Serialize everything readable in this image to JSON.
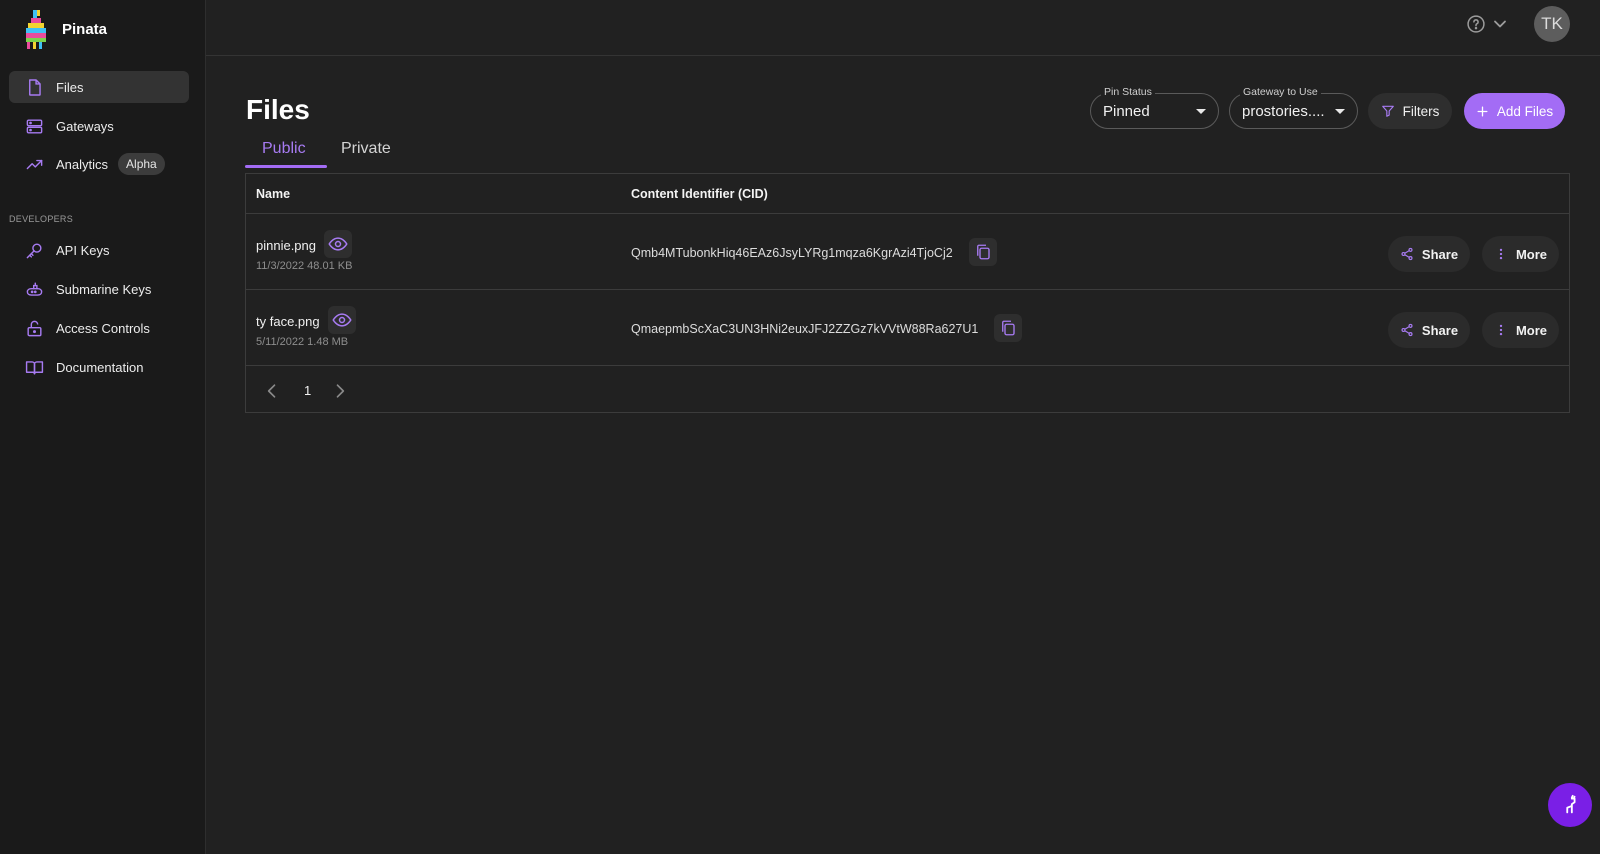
{
  "brand": {
    "name": "Pinata"
  },
  "sidebar": {
    "items": [
      {
        "label": "Files",
        "icon": "file-icon",
        "active": true
      },
      {
        "label": "Gateways",
        "icon": "server-icon"
      },
      {
        "label": "Analytics",
        "icon": "trend-up-icon",
        "badge": "Alpha"
      }
    ],
    "section_label": "DEVELOPERS",
    "dev_items": [
      {
        "label": "API Keys",
        "icon": "key-icon"
      },
      {
        "label": "Submarine Keys",
        "icon": "submarine-icon"
      },
      {
        "label": "Access Controls",
        "icon": "lock-icon"
      },
      {
        "label": "Documentation",
        "icon": "book-icon"
      }
    ]
  },
  "topbar": {
    "avatar_initials": "TK",
    "help_icon": "question-circle-icon"
  },
  "page": {
    "title": "Files"
  },
  "controls": {
    "pin_status": {
      "label": "Pin Status",
      "value": "Pinned"
    },
    "gateway": {
      "label": "Gateway to Use",
      "value": "prostories...."
    },
    "filters_label": "Filters",
    "add_files_label": "Add Files"
  },
  "tabs": [
    {
      "label": "Public",
      "active": true
    },
    {
      "label": "Private",
      "active": false
    }
  ],
  "table": {
    "headers": {
      "name": "Name",
      "cid": "Content Identifier (CID)"
    },
    "rows": [
      {
        "name": "pinnie.png",
        "meta": "11/3/2022 48.01 KB",
        "cid": "Qmb4MTubonkHiq46EAz6JsyLYRg1mqza6KgrAzi4TjoCj2",
        "share": "Share",
        "more": "More"
      },
      {
        "name": "ty face.png",
        "meta": "5/11/2022 1.48 MB",
        "cid": "QmaepmbScXaC3UN3HNi2euxJFJ2ZZGz7kVVtW88Ra627U1",
        "share": "Share",
        "more": "More"
      }
    ],
    "pagination": {
      "current_page": "1"
    }
  },
  "colors": {
    "accent": "#a36cf5",
    "background": "#212121",
    "sidebar": "#1a1a1a",
    "fab": "#7a1fe6"
  }
}
